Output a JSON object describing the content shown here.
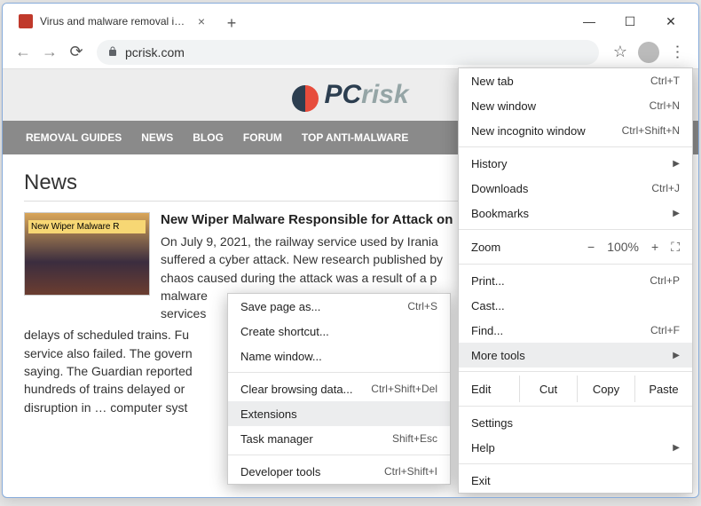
{
  "window": {
    "tab_title": "Virus and malware removal instru",
    "url_display": "pcrisk.com"
  },
  "site": {
    "logo_text_bold": "PC",
    "logo_text_faded": "risk",
    "nav": [
      "REMOVAL GUIDES",
      "NEWS",
      "BLOG",
      "FORUM",
      "TOP ANTI-MALWARE"
    ]
  },
  "page": {
    "heading": "News",
    "thumb_label": "New Wiper Malware R",
    "article_title": "New Wiper Malware Responsible for Attack on ",
    "article_lead": "On July 9, 2021, the railway service used by Irania",
    "article_lines": [
      "suffered a cyber attack. New research published by",
      "chaos caused during the attack was a result of a p",
      "malware",
      "services"
    ],
    "article_rest": "delays of scheduled trains. Fu\nservice also failed. The govern\nsaying. The Guardian reported\nhundreds of trains delayed or\ndisruption in … computer syst"
  },
  "chrome_menu": {
    "new_tab": {
      "label": "New tab",
      "shortcut": "Ctrl+T"
    },
    "new_window": {
      "label": "New window",
      "shortcut": "Ctrl+N"
    },
    "new_incognito": {
      "label": "New incognito window",
      "shortcut": "Ctrl+Shift+N"
    },
    "history": {
      "label": "History"
    },
    "downloads": {
      "label": "Downloads",
      "shortcut": "Ctrl+J"
    },
    "bookmarks": {
      "label": "Bookmarks"
    },
    "zoom": {
      "label": "Zoom",
      "value": "100%"
    },
    "print": {
      "label": "Print...",
      "shortcut": "Ctrl+P"
    },
    "cast": {
      "label": "Cast..."
    },
    "find": {
      "label": "Find...",
      "shortcut": "Ctrl+F"
    },
    "more_tools": {
      "label": "More tools"
    },
    "edit": {
      "label": "Edit",
      "cut": "Cut",
      "copy": "Copy",
      "paste": "Paste"
    },
    "settings": {
      "label": "Settings"
    },
    "help": {
      "label": "Help"
    },
    "exit": {
      "label": "Exit"
    }
  },
  "sub_menu": {
    "save_page": {
      "label": "Save page as...",
      "shortcut": "Ctrl+S"
    },
    "create_shortcut": {
      "label": "Create shortcut..."
    },
    "name_window": {
      "label": "Name window..."
    },
    "clear_browsing": {
      "label": "Clear browsing data...",
      "shortcut": "Ctrl+Shift+Del"
    },
    "extensions": {
      "label": "Extensions"
    },
    "task_manager": {
      "label": "Task manager",
      "shortcut": "Shift+Esc"
    },
    "developer_tools": {
      "label": "Developer tools",
      "shortcut": "Ctrl+Shift+I"
    }
  }
}
